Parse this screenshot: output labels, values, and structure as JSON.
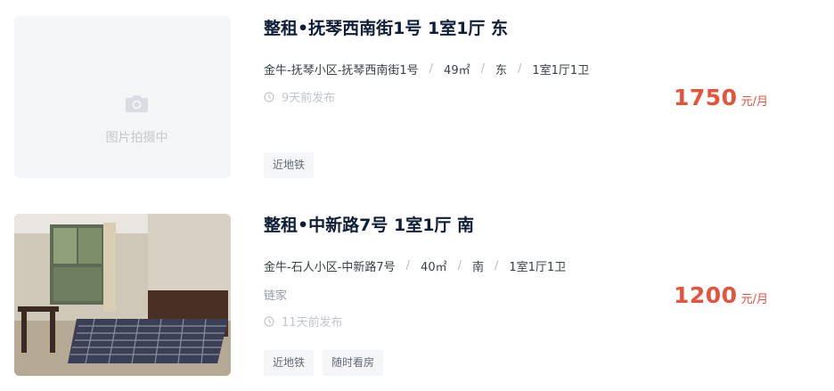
{
  "listings": [
    {
      "title": "整租•抚琴西南街1号 1室1厅 东",
      "photo_placeholder": "图片拍摄中",
      "has_photo": false,
      "location": "金牛-抚琴小区-抚琴西南街1号",
      "area": "49㎡",
      "orientation": "东",
      "layout": "1室1厅1卫",
      "agency": "",
      "posted": "9天前发布",
      "price": "1750",
      "price_unit": "元/月",
      "tags": [
        "近地铁"
      ]
    },
    {
      "title": "整租•中新路7号 1室1厅 南",
      "photo_placeholder": "",
      "has_photo": true,
      "photo_icon": "bedroom-photo",
      "location": "金牛-石人小区-中新路7号",
      "area": "40㎡",
      "orientation": "南",
      "layout": "1室1厅1卫",
      "agency": "链家",
      "posted": "11天前发布",
      "price": "1200",
      "price_unit": "元/月",
      "tags": [
        "近地铁",
        "随时看房"
      ]
    }
  ],
  "colors": {
    "price": "#e4533c",
    "title": "#101d37",
    "tag_bg": "#f4f6f8",
    "placeholder_bg": "#f4f5f7"
  },
  "spec_separator": "/"
}
